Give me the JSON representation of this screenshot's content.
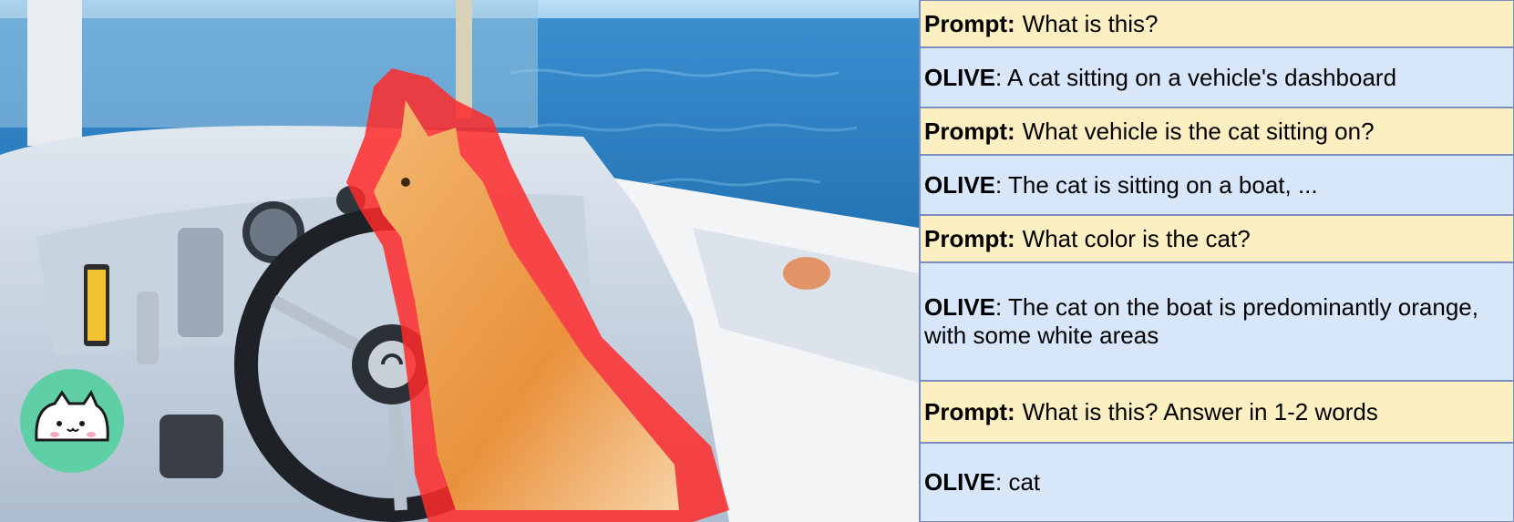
{
  "qa": [
    {
      "type": "prompt",
      "label": "Prompt:",
      "text": "What is this?"
    },
    {
      "type": "answer",
      "label": "OLIVE",
      "text": ": A cat sitting on a vehicle's dashboard"
    },
    {
      "type": "prompt",
      "label": "Prompt:",
      "text": "What vehicle is the cat sitting on?"
    },
    {
      "type": "answer",
      "label": "OLIVE",
      "text": ": The cat is sitting on a boat, ..."
    },
    {
      "type": "prompt",
      "label": "Prompt:",
      "text": "What color is the cat?"
    },
    {
      "type": "answer",
      "label": "OLIVE",
      "text": ": The cat on the boat is predominantly orange, with some white areas"
    },
    {
      "type": "prompt",
      "label": "Prompt:",
      "text": "What is this? Answer in 1-2 words"
    },
    {
      "type": "answer",
      "label": "OLIVE",
      "text": ": cat"
    }
  ],
  "colors": {
    "prompt_bg": "#fcefc2",
    "answer_bg": "#d8e6fa",
    "border": "#7a8fbf",
    "mask": "#ff2a2a",
    "logo_circle": "#5fcfa5"
  },
  "icons": {
    "logo": "bongo-cat-icon"
  }
}
